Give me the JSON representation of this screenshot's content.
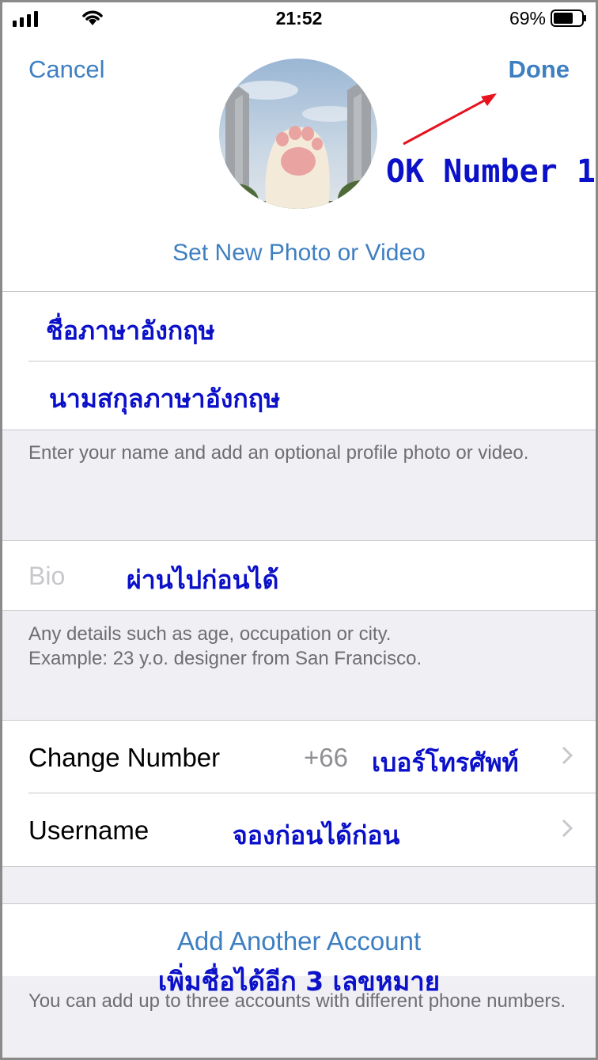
{
  "status_bar": {
    "time": "21:52",
    "battery_percent": "69%",
    "battery_level": 0.69,
    "icons": [
      "cellular-signal-icon",
      "wifi-icon",
      "battery-icon"
    ]
  },
  "header": {
    "cancel_label": "Cancel",
    "done_label": "Done",
    "set_photo_label": "Set New Photo or Video",
    "annotation_done": "OK Number 1"
  },
  "name_fields": {
    "first_name_note": "ชื่อภาษาอังกฤษ",
    "last_name_note": "นามสกุลภาษาอังกฤษ",
    "footnote": "Enter your name and add an optional profile photo or video."
  },
  "bio": {
    "placeholder": "Bio",
    "note": "ผ่านไปก่อนได้",
    "footnote_line1": "Any details such as age, occupation or city.",
    "footnote_line2": "Example: 23 y.o. designer from San Francisco."
  },
  "contact": {
    "change_number_label": "Change Number",
    "phone_prefix": "+66",
    "phone_note": "เบอร์โทรศัพท์",
    "username_label": "Username",
    "username_note": "จองก่อนได้ก่อน"
  },
  "accounts": {
    "add_account_label": "Add Another Account",
    "add_account_note": "เพิ่มชื่อได้อีก 3 เลขหมาย",
    "footnote": "You can add up to three accounts with different phone numbers."
  },
  "colors": {
    "accent": "#3e7fc1",
    "annotation_blue": "#0b10c9",
    "annotation_arrow": "#e8121e",
    "background": "#efeff4"
  }
}
